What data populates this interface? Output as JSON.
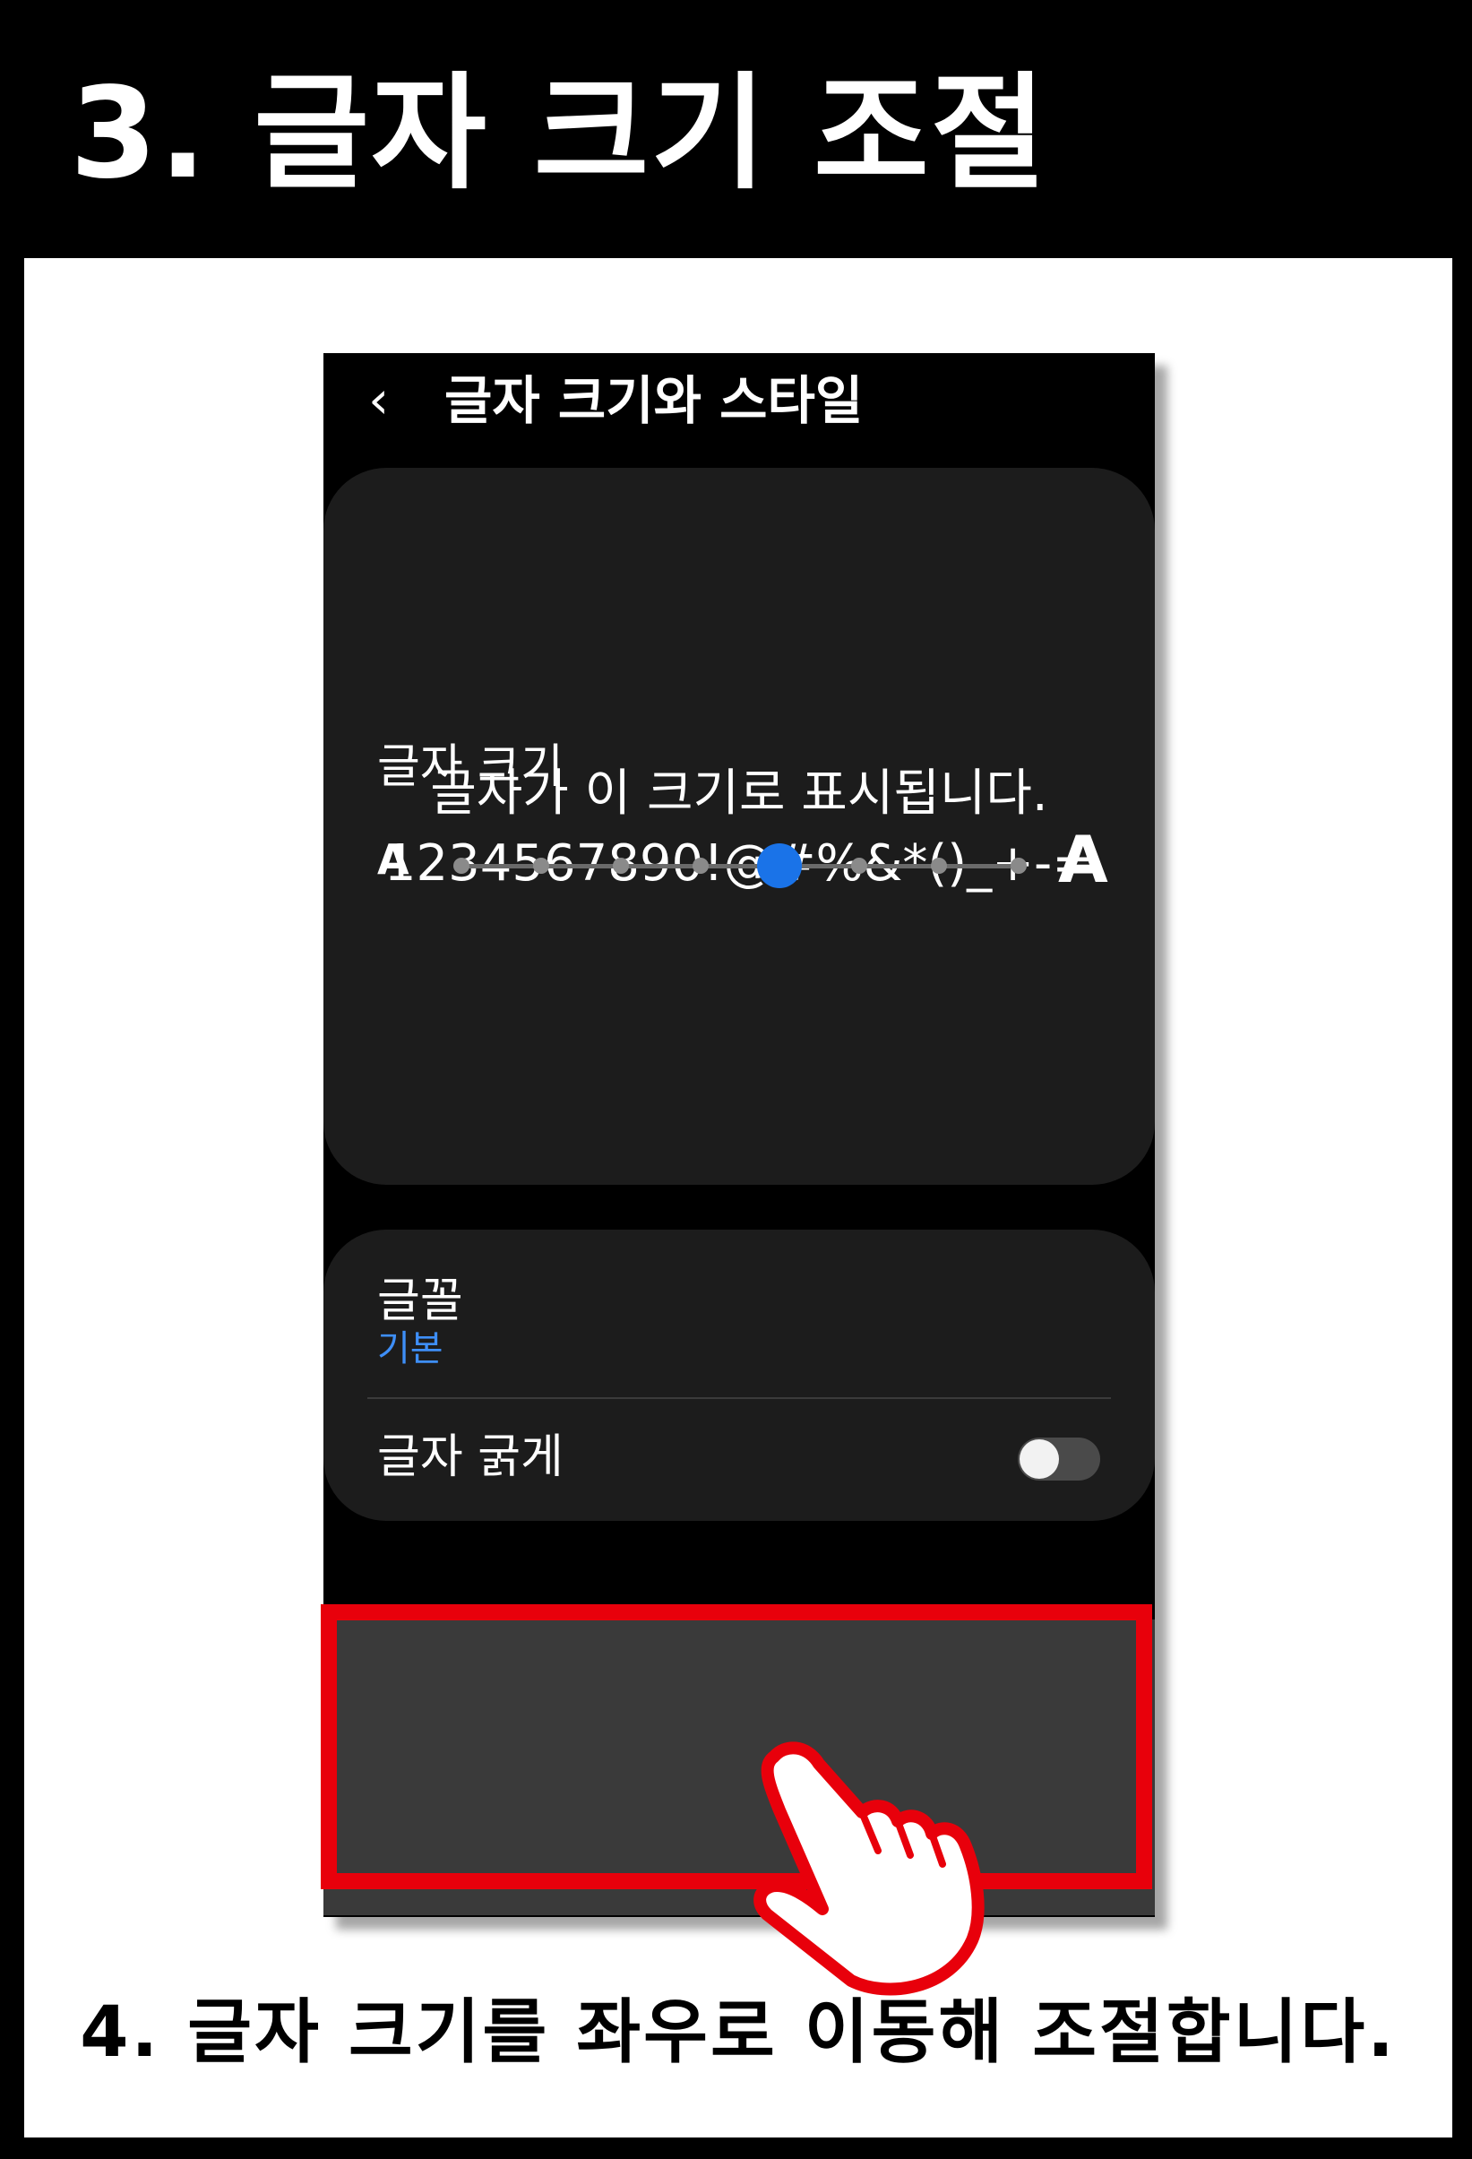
{
  "header": {
    "title": "3. 글자 크기 조절"
  },
  "screen": {
    "title": "글자 크기와 스타일",
    "preview": {
      "line1": "글자가 이 크기로 표시됩니다.",
      "line2": "1234567890!@#%&*()_+-="
    },
    "font": {
      "label": "글꼴",
      "value": "기본"
    },
    "bold_text": {
      "label": "글자 굵게",
      "enabled": false
    },
    "text_size": {
      "label": "글자 크기",
      "small_symbol": "A",
      "large_symbol": "A",
      "steps": 8,
      "current_step": 5
    }
  },
  "caption": "4. 글자 크기를 좌우로 이동해 조절합니다.",
  "colors": {
    "accent": "#1a73e8",
    "link": "#3e8ff8",
    "highlight": "#e8000b"
  }
}
